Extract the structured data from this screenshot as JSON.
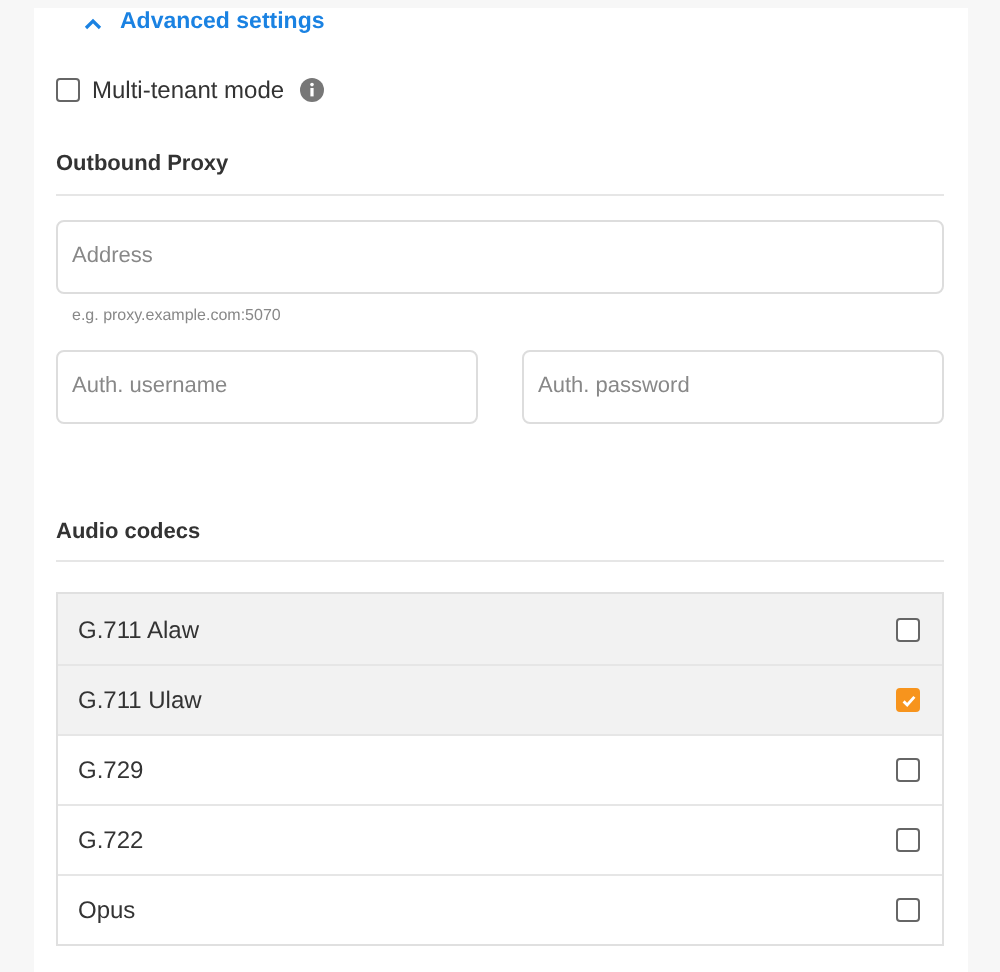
{
  "advanced_toggle": {
    "label": "Advanced settings",
    "expanded": true
  },
  "multi_tenant": {
    "label": "Multi-tenant mode",
    "checked": false
  },
  "outbound_proxy": {
    "heading": "Outbound Proxy",
    "address": {
      "placeholder": "Address",
      "hint": "e.g. proxy.example.com:5070"
    },
    "username": {
      "placeholder": "Auth. username"
    },
    "password": {
      "placeholder": "Auth. password"
    }
  },
  "audio_codecs": {
    "heading": "Audio codecs",
    "items": [
      {
        "label": "G.711 Alaw",
        "checked": false,
        "highlighted": true
      },
      {
        "label": "G.711 Ulaw",
        "checked": true,
        "highlighted": true
      },
      {
        "label": "G.729",
        "checked": false,
        "highlighted": false
      },
      {
        "label": "G.722",
        "checked": false,
        "highlighted": false
      },
      {
        "label": "Opus",
        "checked": false,
        "highlighted": false
      }
    ]
  }
}
